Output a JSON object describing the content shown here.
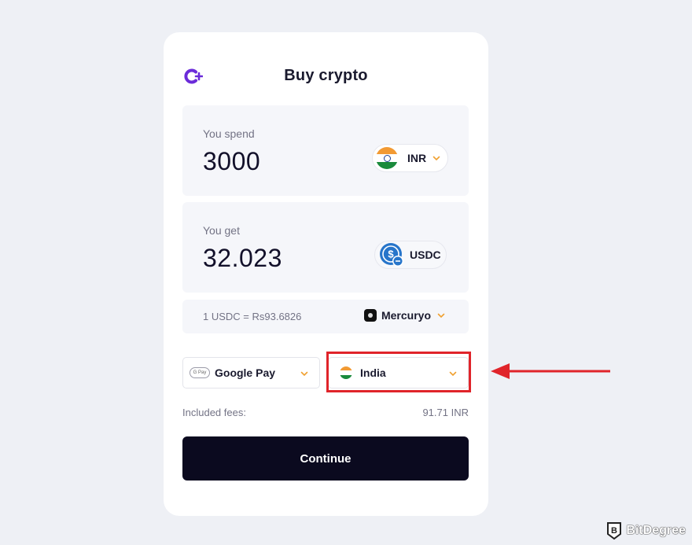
{
  "header": {
    "title": "Buy crypto",
    "logo_icon": "plus-c-logo-icon",
    "accent": "#6b2bd9"
  },
  "spend": {
    "label": "You spend",
    "amount": "3000",
    "currency": "INR",
    "currency_icon": "india-flag-icon"
  },
  "get": {
    "label": "You get",
    "amount": "32.023",
    "currency": "USDC",
    "currency_icon": "usdc-coin-icon"
  },
  "rate": {
    "text": "1 USDC = Rs93.6826",
    "provider": "Mercuryo",
    "provider_icon": "mercuryo-logo-icon"
  },
  "payment": {
    "method": "Google Pay",
    "method_icon": "gpay-icon",
    "gpay_mark": "G Pay",
    "country": "India",
    "country_icon": "india-flag-icon"
  },
  "fees": {
    "label": "Included fees:",
    "value": "91.71 INR"
  },
  "actions": {
    "continue_label": "Continue"
  },
  "annotation": {
    "highlight_color": "#e0242a",
    "target": "country-select"
  },
  "watermark": {
    "text": "BitDegree"
  },
  "colors": {
    "chevron": "#f0a030",
    "button_bg": "#0b0a1f",
    "page_bg": "#eef0f5"
  }
}
